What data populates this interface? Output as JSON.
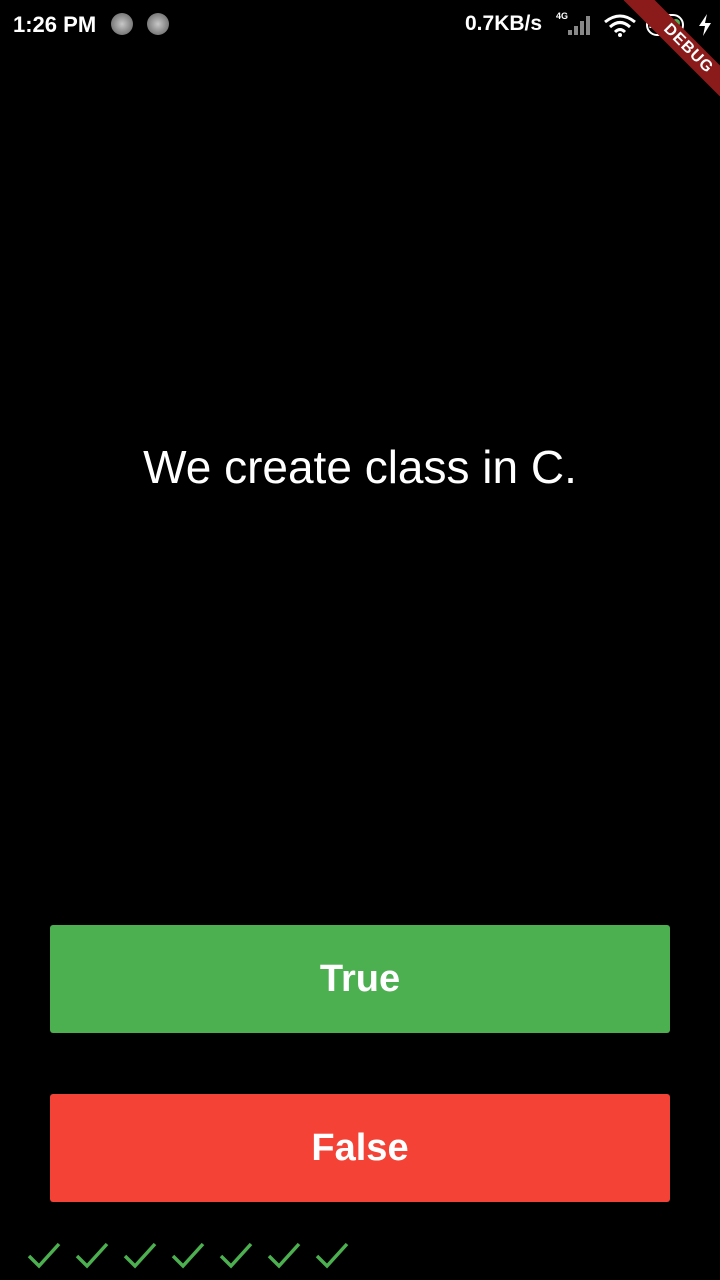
{
  "status_bar": {
    "time": "1:26 PM",
    "net_speed": "0.7KB/s",
    "network_type": "4G",
    "battery_level": "24",
    "icons": [
      "notification-icon",
      "notification-icon",
      "signal-icon",
      "wifi-icon",
      "battery-icon",
      "charging-icon"
    ]
  },
  "debug_banner": {
    "label": "DEBUG",
    "color": "#8b1a1a"
  },
  "quiz": {
    "question": "We create class in C.",
    "true_label": "True",
    "false_label": "False",
    "true_color": "#4caf50",
    "false_color": "#f44336"
  },
  "score": {
    "results": [
      "correct",
      "correct",
      "correct",
      "correct",
      "correct",
      "correct",
      "correct"
    ],
    "check_color": "#4caf50"
  }
}
